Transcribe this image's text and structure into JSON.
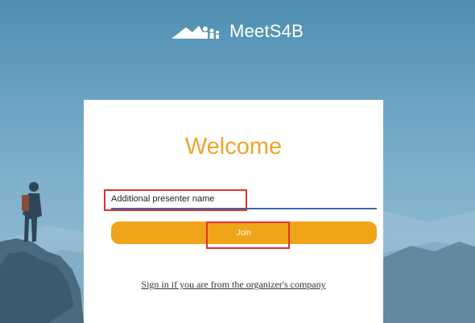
{
  "brand": {
    "name": "MeetS4B",
    "logo_icon": "mountain-people-logo-icon"
  },
  "card": {
    "title": "Welcome",
    "name_input": {
      "value": "Additional presenter name",
      "placeholder": ""
    },
    "join_label": "Join",
    "signin_link": "Sign in if you are from the organizer's company"
  },
  "colors": {
    "accent": "#f0a41a",
    "title": "#f0a32c",
    "input_underline": "#3c6aa0",
    "highlight": "#e03232"
  }
}
